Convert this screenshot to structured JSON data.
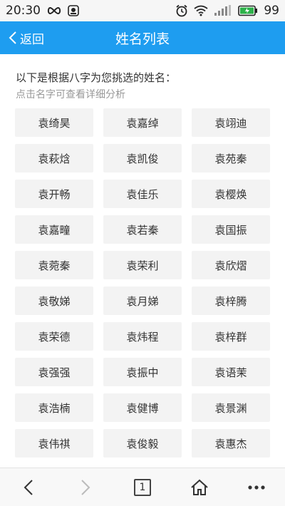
{
  "status_bar": {
    "time": "20:30",
    "battery_level": "99",
    "icons": [
      "infinity-icon",
      "notification-icon",
      "alarm-icon",
      "wifi-icon",
      "signal-icon",
      "battery-icon"
    ]
  },
  "nav": {
    "back_label": "返回",
    "title": "姓名列表",
    "color": "#1e9df0"
  },
  "intro": {
    "text": "以下是根据八字为您挑选的姓名：",
    "hint": "点击名字可查看详细分析"
  },
  "names": [
    "袁绮昊",
    "袁嘉绰",
    "袁翊迪",
    "袁萩焓",
    "袁凯俊",
    "袁苑秦",
    "袁开畅",
    "袁佳乐",
    "袁樱焕",
    "袁嘉疃",
    "袁若秦",
    "袁国振",
    "袁菀秦",
    "袁荣利",
    "袁欣熠",
    "袁敬娣",
    "袁月娣",
    "袁梓腾",
    "袁荣德",
    "袁炜程",
    "袁梓群",
    "袁强强",
    "袁振中",
    "袁语茉",
    "袁浩楠",
    "袁健博",
    "袁景渊",
    "袁伟祺",
    "袁俊毅",
    "袁惠杰"
  ],
  "bottom_bar": {
    "tab_count": "1",
    "icons": [
      "back-arrow-icon",
      "forward-arrow-icon",
      "tabs-icon",
      "home-icon",
      "more-icon"
    ]
  }
}
